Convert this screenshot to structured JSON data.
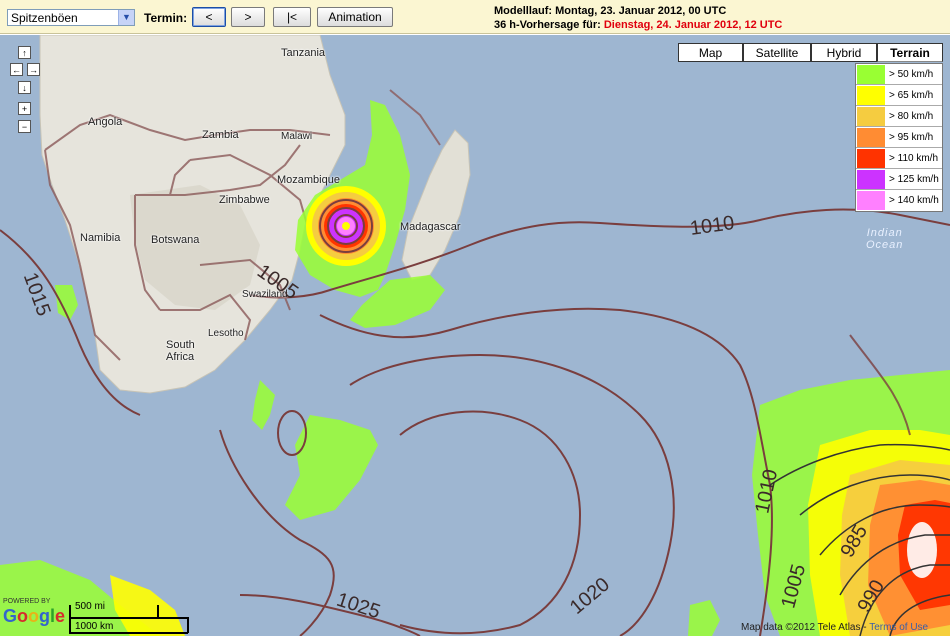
{
  "toolbar": {
    "parameter_select": "Spitzenböen",
    "termin_label": "Termin:",
    "prev_button": "<",
    "next_button": ">",
    "first_button": "|<",
    "animation_button": "Animation",
    "modelllauf": "Modelllauf: Montag, 23. Januar 2012, 00 UTC",
    "vorhersage_prefix": "36 h-Vorhersage für:",
    "vorhersage_date": "Dienstag, 24. Januar 2012, 12 UTC"
  },
  "map_type": {
    "map": "Map",
    "satellite": "Satellite",
    "hybrid": "Hybrid",
    "terrain": "Terrain",
    "selected": "Terrain"
  },
  "navigation": {
    "up": "↑",
    "left": "←",
    "right": "→",
    "down": "↓",
    "zoom_in": "+",
    "zoom_out": "−"
  },
  "legend": [
    {
      "label": "> 50 km/h",
      "color": "#99ff33"
    },
    {
      "label": "> 65 km/h",
      "color": "#ffff00"
    },
    {
      "label": "> 80 km/h",
      "color": "#f5cc40"
    },
    {
      "label": "> 95 km/h",
      "color": "#ff8c33"
    },
    {
      "label": "> 110 km/h",
      "color": "#ff3300"
    },
    {
      "label": "> 125 km/h",
      "color": "#cc33ff"
    },
    {
      "label": "> 140 km/h",
      "color": "#ff80ff"
    }
  ],
  "places": {
    "tanzania": "Tanzania",
    "angola": "Angola",
    "zambia": "Zambia",
    "malawi": "Malawi",
    "mozambique": "Mozambique",
    "zimbabwe": "Zimbabwe",
    "madagascar": "Madagascar",
    "namibia": "Namibia",
    "botswana": "Botswana",
    "swaziland": "Swaziland",
    "lesotho": "Lesotho",
    "south_africa_1": "South",
    "south_africa_2": "Africa",
    "indian_ocean_1": "Indian",
    "indian_ocean_2": "Ocean"
  },
  "isobars": {
    "i1015": "1015",
    "i1005": "1005",
    "i1010_top": "1010",
    "i1010_right": "1010",
    "i985": "985",
    "i1005_right": "1005",
    "i990": "990",
    "i1025": "1025",
    "i1020": "1020"
  },
  "footer": {
    "powered_by": "POWERED BY",
    "google": "Google",
    "scale_mi": "500 mi",
    "scale_km": "1000 km",
    "map_data": "Map data ©2012 Tele Atlas -",
    "terms": "Terms of Use"
  }
}
